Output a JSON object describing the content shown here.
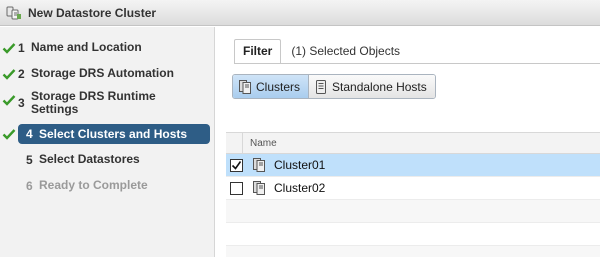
{
  "window": {
    "title": "New Datastore Cluster",
    "icon": "datastore-cluster-icon"
  },
  "wizard": {
    "steps": [
      {
        "num": "1",
        "label": "Name and Location",
        "state": "done"
      },
      {
        "num": "2",
        "label": "Storage DRS Automation",
        "state": "done"
      },
      {
        "num": "3",
        "label": "Storage DRS Runtime Settings",
        "state": "done"
      },
      {
        "num": "4",
        "label": "Select Clusters and Hosts",
        "state": "active"
      },
      {
        "num": "5",
        "label": "Select Datastores",
        "state": "pending"
      },
      {
        "num": "6",
        "label": "Ready to Complete",
        "state": "disabled"
      }
    ]
  },
  "tabs": {
    "filter": "Filter",
    "selected": "(1) Selected Objects"
  },
  "toggle": {
    "clusters": "Clusters",
    "standalone": "Standalone Hosts",
    "selected": "Clusters"
  },
  "grid": {
    "header": "Name",
    "rows": [
      {
        "name": "Cluster01",
        "checked": true
      },
      {
        "name": "Cluster02",
        "checked": false
      }
    ]
  },
  "colors": {
    "active_step": "#2e5d86",
    "check": "#3a9a2a",
    "selected_row": "#bfe0fb"
  }
}
